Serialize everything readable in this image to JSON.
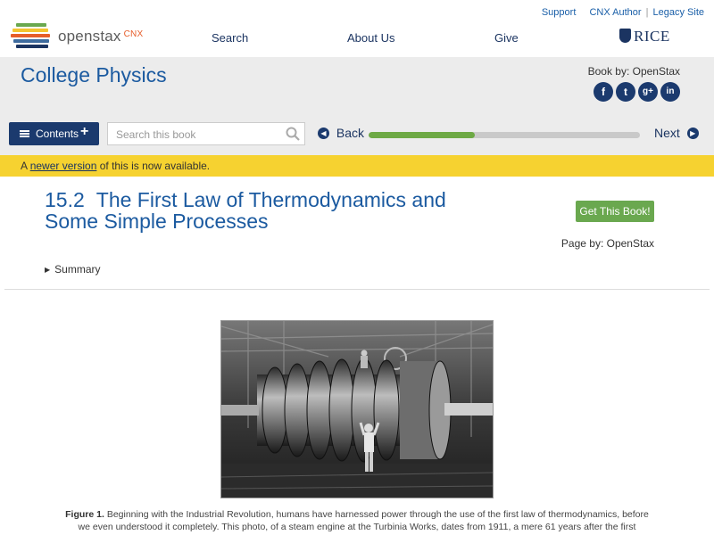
{
  "header": {
    "logo_text": "openstax",
    "logo_suffix": "CNX",
    "logo_bar_colors": [
      "#6aa84f",
      "#f4c430",
      "#e65d2a",
      "#3e6b9e",
      "#1b3461"
    ],
    "util_links": [
      "Support",
      "CNX Author",
      "Legacy Site"
    ],
    "nav": {
      "search": "Search",
      "about": "About Us",
      "give": "Give"
    },
    "rice_label": "RICE"
  },
  "book": {
    "title": "College Physics",
    "book_by": "Book by: OpenStax",
    "social": [
      "f",
      "t",
      "g+",
      "in"
    ],
    "contents_label": "Contents",
    "search_placeholder": "Search this book",
    "back_label": "Back",
    "next_label": "Next",
    "progress_fraction": 0.39
  },
  "notice": {
    "prefix": "A ",
    "link": "newer version",
    "suffix": " of this is now available."
  },
  "page": {
    "section_number": "15.2",
    "section_title": "The First Law of Thermodynamics and Some Simple Processes",
    "get_book_label": "Get This Book!",
    "page_by": "Page by: OpenStax",
    "summary_label": "Summary"
  },
  "figure": {
    "label": "Figure 1.",
    "caption": "Beginning with the Industrial Revolution, humans have harnessed power through the use of the first law of thermodynamics, before we even understood it completely. This photo, of a steam engine at the Turbinia Works, dates from 1911, a mere 61 years after the first"
  },
  "colors": {
    "brand_blue": "#1b5aa0",
    "navy": "#1b3a6e",
    "notice_yellow": "#f6d230",
    "progress_green": "#6da944",
    "button_green": "#6aa84f"
  }
}
